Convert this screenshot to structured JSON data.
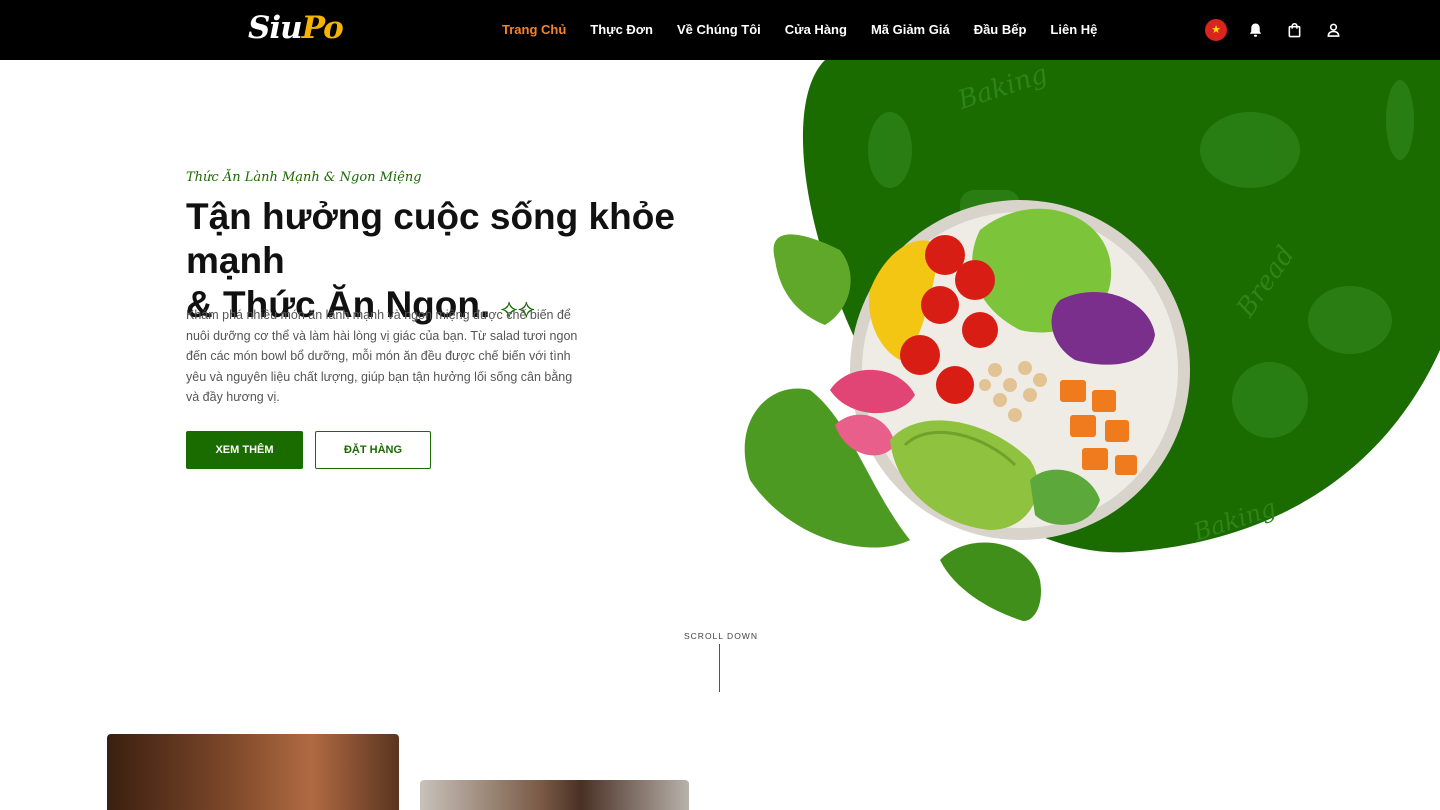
{
  "brand": {
    "logo_part1": "Siu",
    "logo_part2": "Po"
  },
  "nav": {
    "items": [
      {
        "label": "Trang Chủ",
        "active": true
      },
      {
        "label": "Thực Đơn"
      },
      {
        "label": "Về Chúng Tôi"
      },
      {
        "label": "Cửa Hàng"
      },
      {
        "label": "Mã Giảm Giá"
      },
      {
        "label": "Đầu Bếp"
      },
      {
        "label": "Liên Hệ"
      }
    ],
    "icons": [
      "vietnam-flag-icon",
      "bell-icon",
      "shopping-bag-icon",
      "user-icon"
    ]
  },
  "hero": {
    "tagline": "Thức Ăn Lành Mạnh & Ngon Miệng",
    "title_line1": "Tận hưởng cuộc sống khỏe mạnh",
    "title_line2": "& Thức Ăn Ngon.",
    "description": "Khám phá nhiều món ăn lành mạnh và ngon miệng được chế biến để nuôi dưỡng cơ thể và làm hài lòng vị giác của bạn. Từ salad tươi ngon đến các món bowl bổ dưỡng, mỗi món ăn đều được chế biến với tình yêu và nguyên liệu chất lượng, giúp bạn tận hưởng lối sống cân bằng và đầy hương vị.",
    "primary_button": "XEM THÊM",
    "secondary_button": "ĐẶT HÀNG",
    "background_words": [
      "Baking",
      "Bread",
      "Baking"
    ]
  },
  "scroll": {
    "label": "SCROLL DOWN"
  },
  "colors": {
    "brand_green": "#1a6b00",
    "nav_active": "#f0852d",
    "navbar_bg": "#000000",
    "logo_accent": "#f5b400"
  }
}
